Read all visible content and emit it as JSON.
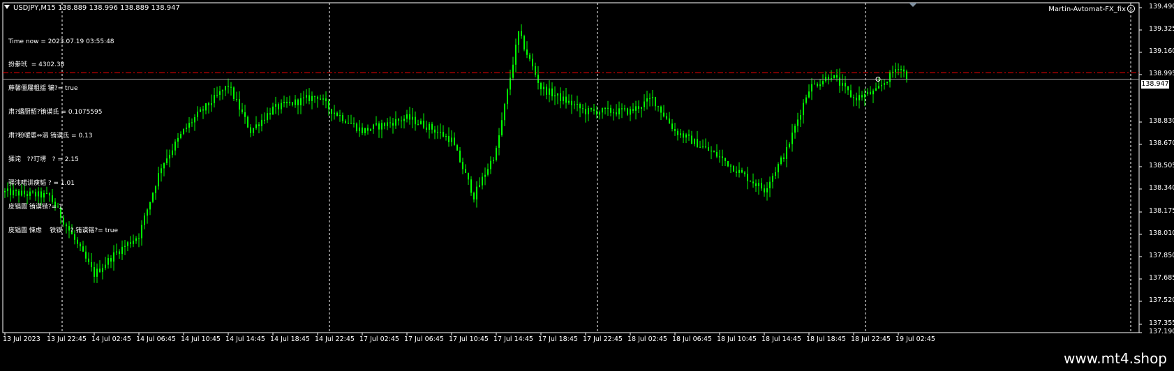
{
  "header": {
    "symbol_line": "USDJPY,M15  138.889 138.996 138.889 138.947",
    "ea_name": "Martin-Avtomat-FX_fix"
  },
  "info_lines": [
    "Time now = 2023.07.19 03:55:48",
    "扮豢玳  = 4302.38",
    "蓐馨僵屨粗揺 犏?= true",
    "肃?蟠厨韶?铕谟氐 = 0.1075595",
    "肃?粉嗳慝⇔泅 铕谟氐 = 0.13",
    "猱诧   ??玎塄   ? = 2.15",
    "驿沌喏讲瘐韬 ? = 1.01",
    "庋锠圊 铕谟锴?= 1",
    "庋锠圊 悚虑    铁锲    ? 铕谟锴?= true"
  ],
  "price_axis": [
    "139.490",
    "139.325",
    "139.160",
    "138.995",
    "138.830",
    "138.670",
    "138.505",
    "138.340",
    "138.175",
    "138.010",
    "137.850",
    "137.685",
    "137.520",
    "137.355",
    "137.190"
  ],
  "current_price_label": "138.947",
  "time_axis": [
    "13 Jul 2023",
    "13 Jul 22:45",
    "14 Jul 02:45",
    "14 Jul 06:45",
    "14 Jul 10:45",
    "14 Jul 14:45",
    "14 Jul 18:45",
    "14 Jul 22:45",
    "17 Jul 02:45",
    "17 Jul 06:45",
    "17 Jul 10:45",
    "17 Jul 14:45",
    "17 Jul 18:45",
    "17 Jul 22:45",
    "18 Jul 02:45",
    "18 Jul 06:45",
    "18 Jul 10:45",
    "18 Jul 14:45",
    "18 Jul 18:45",
    "18 Jul 22:45",
    "19 Jul 02:45"
  ],
  "footer": {
    "site": "www.mt4.shop"
  },
  "colors": {
    "candle": "#00ff00",
    "background": "#000000",
    "separator": "#ffffff",
    "level_line": "#ff0000",
    "bid_line": "#a0a0a0",
    "text": "#ffffff"
  },
  "chart_data": {
    "type": "candlestick",
    "symbol": "USDJPY",
    "timeframe": "M15",
    "last_bar": {
      "open": 138.889,
      "high": 138.996,
      "low": 138.889,
      "close": 138.947
    },
    "ylim": [
      137.19,
      139.49
    ],
    "price_path": [
      [
        "13 Jul 2023",
        138.08
      ],
      [
        "13 Jul 22:45",
        138.05
      ],
      [
        "14 Jul 02:45",
        137.45
      ],
      [
        "14 Jul 04:45",
        137.62
      ],
      [
        "14 Jul 06:45",
        137.75
      ],
      [
        "14 Jul 08:45",
        138.28
      ],
      [
        "14 Jul 10:45",
        138.55
      ],
      [
        "14 Jul 12:45",
        138.65
      ],
      [
        "14 Jul 14:45",
        138.9
      ],
      [
        "14 Jul 16:45",
        138.55
      ],
      [
        "14 Jul 18:45",
        138.72
      ],
      [
        "14 Jul 22:45",
        138.82
      ],
      [
        "17 Jul 00:45",
        138.72
      ],
      [
        "17 Jul 02:45",
        138.55
      ],
      [
        "17 Jul 06:45",
        138.65
      ],
      [
        "17 Jul 08:45",
        138.58
      ],
      [
        "17 Jul 10:45",
        138.48
      ],
      [
        "17 Jul 12:45",
        138.05
      ],
      [
        "17 Jul 14:45",
        138.4
      ],
      [
        "17 Jul 16:45",
        139.3
      ],
      [
        "17 Jul 18:45",
        138.88
      ],
      [
        "17 Jul 22:45",
        138.7
      ],
      [
        "18 Jul 02:45",
        138.7
      ],
      [
        "18 Jul 04:45",
        138.8
      ],
      [
        "18 Jul 06:45",
        138.55
      ],
      [
        "18 Jul 10:45",
        138.35
      ],
      [
        "18 Jul 12:45",
        138.22
      ],
      [
        "18 Jul 14:45",
        138.1
      ],
      [
        "18 Jul 16:45",
        138.4
      ],
      [
        "18 Jul 18:45",
        138.88
      ],
      [
        "18 Jul 20:45",
        138.98
      ],
      [
        "18 Jul 22:45",
        138.8
      ],
      [
        "19 Jul 00:45",
        138.85
      ],
      [
        "19 Jul 02:45",
        139.05
      ],
      [
        "19 Jul 03:45",
        138.947
      ]
    ],
    "levels": [
      {
        "price": 138.995,
        "style": "dash-dot",
        "color": "#ff0000"
      },
      {
        "price": 138.947,
        "style": "solid",
        "color": "#a0a0a0"
      }
    ]
  }
}
